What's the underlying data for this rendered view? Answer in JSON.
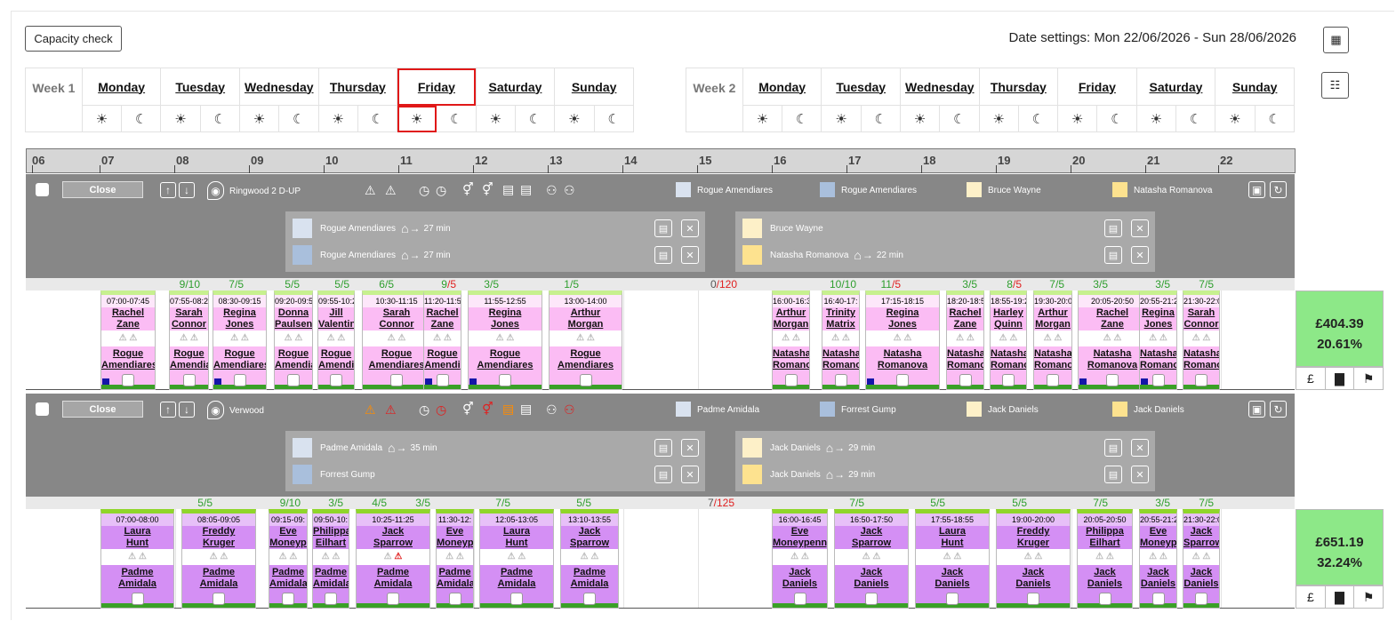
{
  "capacity_check": "Capacity check",
  "date_settings": "Date settings: Mon 22/06/2026 - Sun 28/06/2026",
  "week1": {
    "label": "Week 1",
    "days": [
      "Monday",
      "Tuesday",
      "Wednesday",
      "Thursday",
      "Friday",
      "Saturday",
      "Sunday"
    ],
    "selected": "Friday"
  },
  "week2": {
    "label": "Week 2",
    "days": [
      "Monday",
      "Tuesday",
      "Wednesday",
      "Thursday",
      "Friday",
      "Saturday",
      "Sunday"
    ]
  },
  "hours": [
    "06",
    "07",
    "08",
    "09",
    "10",
    "11",
    "12",
    "13",
    "14",
    "15",
    "16",
    "17",
    "18",
    "19",
    "20",
    "21",
    "22"
  ],
  "groups": [
    {
      "close_label": "Close",
      "location": "Ringwood 2 D-UP",
      "legend": [
        "Rogue Amendiares",
        "Rogue Amendiares",
        "Bruce Wayne",
        "Natasha Romanova"
      ],
      "legend_colors": [
        "#d9e2ef",
        "#a9bfdc",
        "#fdf0c8",
        "#fde28f"
      ],
      "panel_left": [
        {
          "name": "Rogue Amendiares",
          "color": "#d9e2ef",
          "travel": "27 min"
        },
        {
          "name": "Rogue Amendiares",
          "color": "#a9bfdc",
          "travel": "27 min"
        }
      ],
      "panel_right": [
        {
          "name": "Bruce Wayne",
          "color": "#fdf0c8",
          "travel": ""
        },
        {
          "name": "Natasha Romanova",
          "color": "#fde28f",
          "travel": "22 min"
        }
      ],
      "total": {
        "a": "0",
        "b": "120"
      },
      "cost": "£404.39",
      "percent": "20.61%",
      "counts": [
        {
          "a": "9",
          "b": "10"
        },
        {
          "a": "7",
          "b": "5"
        },
        {
          "a": "5",
          "b": "5"
        },
        {
          "a": "5",
          "b": "5"
        },
        {
          "a": "6",
          "b": "5"
        },
        {
          "a": "9",
          "b": "5",
          "red": true
        },
        {
          "a": "3",
          "b": "5"
        },
        {
          "a": "1",
          "b": "5"
        },
        {
          "a": "10",
          "b": "10"
        },
        {
          "a": "11",
          "b": "5",
          "red": true
        },
        {
          "a": "3",
          "b": "5"
        },
        {
          "a": "8",
          "b": "5",
          "red": true
        },
        {
          "a": "7",
          "b": "5"
        },
        {
          "a": "3",
          "b": "5"
        },
        {
          "a": "3",
          "b": "5"
        },
        {
          "a": "7",
          "b": "5"
        }
      ],
      "shifts": [
        {
          "time": "07:00-07:45",
          "first": "Rachel",
          "last": "Zane",
          "c1": "Rogue",
          "c2": "Amendiares",
          "mk": true
        },
        {
          "time": "07:55-08:2",
          "first": "Sarah",
          "last": "Connor",
          "c1": "Rogue",
          "c2": "Amendia",
          "mk": false
        },
        {
          "time": "08:30-09:15",
          "first": "Regina",
          "last": "Jones",
          "c1": "Rogue",
          "c2": "Amendiares",
          "mk": true
        },
        {
          "time": "09:20-09:5",
          "first": "Donna",
          "last": "Paulsen",
          "c1": "Rogue",
          "c2": "Amendia",
          "mk": false
        },
        {
          "time": "09:55-10:2",
          "first": "Jill",
          "last": "Valentin",
          "c1": "Rogue",
          "c2": "Amendi",
          "mk": false
        },
        {
          "time": "10:30-11:15",
          "first": "Sarah",
          "last": "Connor",
          "c1": "Rogue",
          "c2": "Amendiares",
          "mk": false
        },
        {
          "time": "11:20-11:5",
          "first": "Rachel",
          "last": "Zane",
          "c1": "Rogue",
          "c2": "Amendi",
          "mk": true
        },
        {
          "time": "11:55-12:55",
          "first": "Regina",
          "last": "Jones",
          "c1": "Rogue",
          "c2": "Amendiares",
          "mk": true
        },
        {
          "time": "13:00-14:00",
          "first": "Arthur",
          "last": "Morgan",
          "c1": "Rogue",
          "c2": "Amendiares",
          "mk": false
        },
        {
          "time": "16:00-16:3",
          "first": "Arthur",
          "last": "Morgan",
          "c1": "Natasha",
          "c2": "Romano",
          "mk": false
        },
        {
          "time": "16:40-17:",
          "first": "Trinity",
          "last": "Matrix",
          "c1": "Natasha",
          "c2": "Romano",
          "mk": false
        },
        {
          "time": "17:15-18:15",
          "first": "Regina",
          "last": "Jones",
          "c1": "Natasha",
          "c2": "Romanova",
          "mk": true
        },
        {
          "time": "18:20-18:5",
          "first": "Rachel",
          "last": "Zane",
          "c1": "Natasha",
          "c2": "Romano",
          "mk": false
        },
        {
          "time": "18:55-19:2",
          "first": "Harley",
          "last": "Quinn",
          "c1": "Natasha",
          "c2": "Romano",
          "mk": false
        },
        {
          "time": "19:30-20:0",
          "first": "Arthur",
          "last": "Morgan",
          "c1": "Natasha",
          "c2": "Romano",
          "mk": false
        },
        {
          "time": "20:05-20:50",
          "first": "Rachel",
          "last": "Zane",
          "c1": "Natasha",
          "c2": "Romanova",
          "mk": true
        },
        {
          "time": "20:55-21:2",
          "first": "Regina",
          "last": "Jones",
          "c1": "Natasha",
          "c2": "Romano",
          "mk": true
        },
        {
          "time": "21:30-22:0",
          "first": "Sarah",
          "last": "Connor",
          "c1": "Natasha",
          "c2": "Romano",
          "mk": false
        }
      ]
    },
    {
      "close_label": "Close",
      "location": "Verwood",
      "legend": [
        "Padme Amidala",
        "Forrest Gump",
        "Jack Daniels",
        "Jack Daniels"
      ],
      "legend_colors": [
        "#d9e2ef",
        "#a9bfdc",
        "#fdf0c8",
        "#fde28f"
      ],
      "panel_left": [
        {
          "name": "Padme Amidala",
          "color": "#d9e2ef",
          "travel": "35 min"
        },
        {
          "name": "Forrest Gump",
          "color": "#a9bfdc",
          "travel": ""
        }
      ],
      "panel_right": [
        {
          "name": "Jack Daniels",
          "color": "#fdf0c8",
          "travel": "29 min"
        },
        {
          "name": "Jack Daniels",
          "color": "#fde28f",
          "travel": "29 min"
        }
      ],
      "total": {
        "a": "7",
        "b": "125"
      },
      "cost": "£651.19",
      "percent": "32.24%",
      "counts": [
        {
          "a": "5",
          "b": "5"
        },
        {
          "a": "9",
          "b": "10"
        },
        {
          "a": "3",
          "b": "5"
        },
        {
          "a": "4",
          "b": "5"
        },
        {
          "a": "3",
          "b": "5"
        },
        {
          "a": "7",
          "b": "5"
        },
        {
          "a": "5",
          "b": "5"
        },
        {
          "a": "7",
          "b": "5"
        },
        {
          "a": "5",
          "b": "5"
        },
        {
          "a": "5",
          "b": "5"
        },
        {
          "a": "7",
          "b": "5"
        },
        {
          "a": "3",
          "b": "5"
        },
        {
          "a": "7",
          "b": "5"
        }
      ],
      "shifts": [
        {
          "time": "07:00-08:00",
          "first": "Laura",
          "last": "Hunt",
          "c1": "Padme",
          "c2": "Amidala"
        },
        {
          "time": "08:05-09:05",
          "first": "Freddy",
          "last": "Kruger",
          "c1": "Padme",
          "c2": "Amidala"
        },
        {
          "time": "09:15-09:",
          "first": "Eve",
          "last": "Moneyp",
          "c1": "Padme",
          "c2": "Amidala"
        },
        {
          "time": "09:50-10:",
          "first": "Philippa",
          "last": "Eilhart",
          "c1": "Padme",
          "c2": "Amidala"
        },
        {
          "time": "10:25-11:25",
          "first": "Jack",
          "last": "Sparrow",
          "c1": "Padme",
          "c2": "Amidala",
          "warn": true
        },
        {
          "time": "11:30-12:",
          "first": "Eve",
          "last": "Moneyp",
          "c1": "Padme",
          "c2": "Amidala"
        },
        {
          "time": "12:05-13:05",
          "first": "Laura",
          "last": "Hunt",
          "c1": "Padme",
          "c2": "Amidala"
        },
        {
          "time": "13:10-13:55",
          "first": "Jack",
          "last": "Sparrow",
          "c1": "Padme",
          "c2": "Amidala"
        },
        {
          "time": "16:00-16:45",
          "first": "Eve",
          "last": "Moneypenny",
          "c1": "Jack",
          "c2": "Daniels"
        },
        {
          "time": "16:50-17:50",
          "first": "Jack",
          "last": "Sparrow",
          "c1": "Jack",
          "c2": "Daniels"
        },
        {
          "time": "17:55-18:55",
          "first": "Laura",
          "last": "Hunt",
          "c1": "Jack",
          "c2": "Daniels"
        },
        {
          "time": "19:00-20:00",
          "first": "Freddy",
          "last": "Kruger",
          "c1": "Jack",
          "c2": "Daniels"
        },
        {
          "time": "20:05-20:50",
          "first": "Philippa",
          "last": "Eilhart",
          "c1": "Jack",
          "c2": "Daniels"
        },
        {
          "time": "20:55-21:2",
          "first": "Eve",
          "last": "Moneyp",
          "c1": "Jack",
          "c2": "Daniels"
        },
        {
          "time": "21:30-22:0",
          "first": "Jack",
          "last": "Sparrow",
          "c1": "Jack",
          "c2": "Daniels"
        }
      ]
    }
  ]
}
